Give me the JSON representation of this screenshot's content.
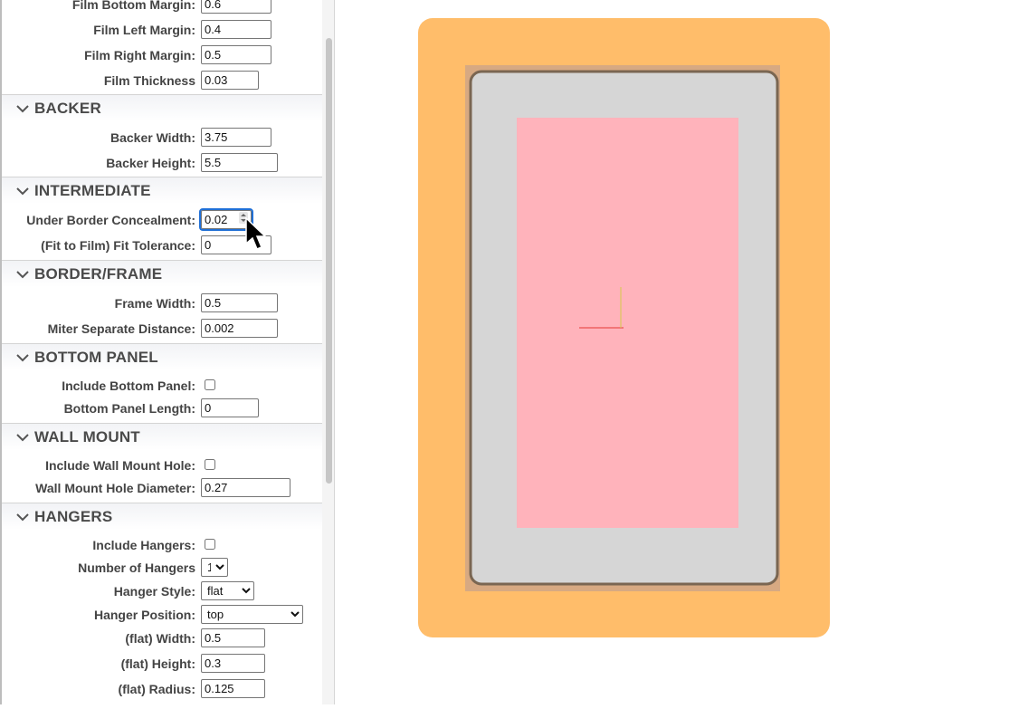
{
  "rows_top": [
    {
      "id": "film_bottom_margin",
      "label": "Film Bottom Margin:",
      "value": "0.6"
    },
    {
      "id": "film_left_margin",
      "label": "Film Left Margin:",
      "value": "0.4"
    },
    {
      "id": "film_right_margin",
      "label": "Film Right Margin:",
      "value": "0.5"
    },
    {
      "id": "film_thickness",
      "label": "Film Thickness",
      "value": "0.03"
    }
  ],
  "sections": {
    "backer": {
      "title": "BACKER",
      "backer_width": {
        "label": "Backer Width:",
        "value": "3.75"
      },
      "backer_height": {
        "label": "Backer Height:",
        "value": "5.5"
      }
    },
    "intermediate": {
      "title": "INTERMEDIATE",
      "under_border": {
        "label": "Under Border Concealment:",
        "value": "0.02"
      },
      "fit_tolerance": {
        "label": "(Fit to Film) Fit Tolerance:",
        "value": "0"
      }
    },
    "border_frame": {
      "title": "BORDER/FRAME",
      "frame_width": {
        "label": "Frame Width:",
        "value": "0.5"
      },
      "miter": {
        "label": "Miter Separate Distance:",
        "value": "0.002"
      }
    },
    "bottom_panel": {
      "title": "BOTTOM PANEL",
      "include": {
        "label": "Include Bottom Panel:",
        "checked": false
      },
      "length": {
        "label": "Bottom Panel Length:",
        "value": "0"
      }
    },
    "wall_mount": {
      "title": "WALL MOUNT",
      "include": {
        "label": "Include Wall Mount Hole:",
        "checked": false
      },
      "diameter": {
        "label": "Wall Mount Hole Diameter:",
        "value": "0.27"
      }
    },
    "hangers": {
      "title": "HANGERS",
      "include": {
        "label": "Include Hangers:",
        "checked": false
      },
      "number": {
        "label": "Number of Hangers",
        "selected": "1"
      },
      "style": {
        "label": "Hanger Style:",
        "selected": "flat"
      },
      "position": {
        "label": "Hanger Position:",
        "selected": "top"
      },
      "flat_width": {
        "label": "(flat) Width:",
        "value": "0.5"
      },
      "flat_height": {
        "label": "(flat) Height:",
        "value": "0.3"
      },
      "flat_radius": {
        "label": "(flat) Radius:",
        "value": "0.125"
      }
    }
  },
  "icons": {
    "section_toggle": "chevron-down-icon",
    "pointer": "mouse-cursor-icon"
  },
  "colors": {
    "frame_outer": "#ffbd6a",
    "mat_edge": "#d7a982",
    "border_inner": "#d6d6d6",
    "border_stroke": "#7a6652",
    "film": "#ffb3bb",
    "axis_x": "#e53935",
    "axis_y": "#d4c84a"
  }
}
